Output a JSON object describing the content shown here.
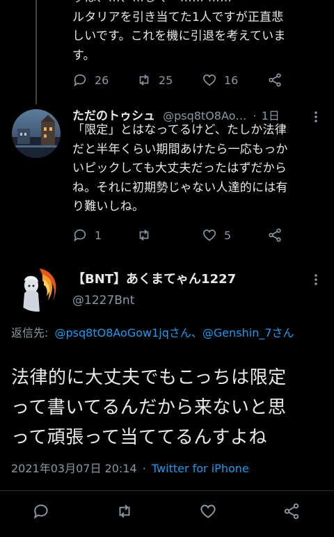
{
  "tweet_top": {
    "text_lines": [
      "ルタリアを引き当てた1人ですが正直悲",
      "しいです。これを機に引退を考えていま",
      "す。"
    ],
    "partial_line": "ッは、…、…しくー…… ……",
    "replies": "26",
    "retweets": "25",
    "likes": "16"
  },
  "tweet_reply": {
    "display_name": "ただのトゥシュ",
    "handle": "@psq8tO8Ao…",
    "separator": "·",
    "time": "1日",
    "text_lines": [
      "「限定」とはなってるけど、たしか法律",
      "だと半年くらい期間あけたら一応もっか",
      "いピックしても大丈夫だったはずだから",
      "ね。それに初期勢じゃない人達的には有",
      "り難いしね。"
    ],
    "replies": "1",
    "retweets": "",
    "likes": "5"
  },
  "main_tweet": {
    "display_name": "【BNT】あくまてゃん1227",
    "handle": "@1227Bnt",
    "replying_to_label": "返信先:",
    "replying_to_accounts": "@psq8tO8AoGow1jqさん、@Genshin_7さん",
    "text_lines": [
      "法律的に大丈夫でもこっちは限定",
      "って書いてるんだから来ないと思",
      "って頑張って当ててるんすよね"
    ],
    "timestamp": "2021年03月07日 20:14",
    "separator": "·",
    "client": "Twitter for iPhone"
  },
  "colors": {
    "background": "#000000",
    "text": "#e7e9ea",
    "muted": "#8b98a5",
    "link": "#1d9bf0",
    "thread_line": "#3d4248"
  },
  "icons": [
    "reply-icon",
    "retweet-icon",
    "like-icon",
    "share-icon",
    "more-icon"
  ]
}
